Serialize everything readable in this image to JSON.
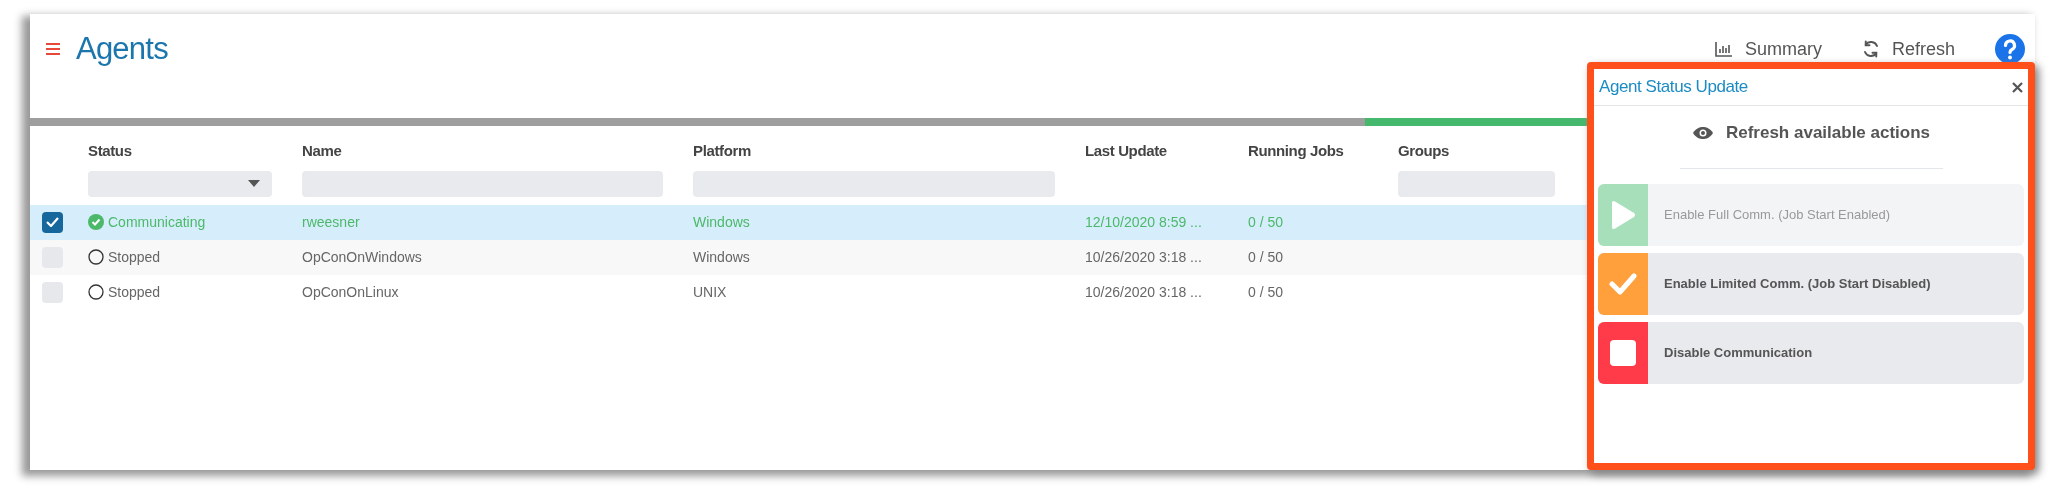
{
  "header": {
    "title": "Agents",
    "actions": [
      {
        "kind": "summary",
        "label": "Summary"
      },
      {
        "kind": "refresh",
        "label": "Refresh"
      }
    ]
  },
  "table": {
    "columns": [
      {
        "label": "Status",
        "kind": "dropdown"
      },
      {
        "label": "Name",
        "kind": "text"
      },
      {
        "label": "Platform",
        "kind": "text"
      },
      {
        "label": "Last Update",
        "kind": "none"
      },
      {
        "label": "Running Jobs",
        "kind": "none"
      },
      {
        "label": "Groups",
        "kind": "text"
      }
    ],
    "rows": [
      {
        "selected": true,
        "kind": "communicating",
        "status": "Communicating",
        "name": "rweesner",
        "platform": "Windows",
        "last_update": "12/10/2020 8:59 ...",
        "running_jobs": "0 / 50"
      },
      {
        "selected": false,
        "kind": "stopped",
        "status": "Stopped",
        "name": "OpConOnWindows",
        "platform": "Windows",
        "last_update": "10/26/2020 3:18 ...",
        "running_jobs": "0 / 50"
      },
      {
        "selected": false,
        "kind": "stopped",
        "status": "Stopped",
        "name": "OpConOnLinux",
        "platform": "UNIX",
        "last_update": "10/26/2020 3:18 ...",
        "running_jobs": "0 / 50"
      }
    ]
  },
  "panel": {
    "title": "Agent Status Update",
    "refresh_label": "Refresh available actions",
    "actions": [
      {
        "kind": "play",
        "label": "Enable Full Comm. (Job Start Enabled)",
        "disabled": true,
        "color": "#a8dfbb"
      },
      {
        "kind": "check",
        "label": "Enable Limited Comm. (Job Start Disabled)",
        "disabled": false,
        "color": "#ffa03d"
      },
      {
        "kind": "stop",
        "label": "Disable Communication",
        "disabled": false,
        "color": "#ff3b4a"
      }
    ]
  }
}
